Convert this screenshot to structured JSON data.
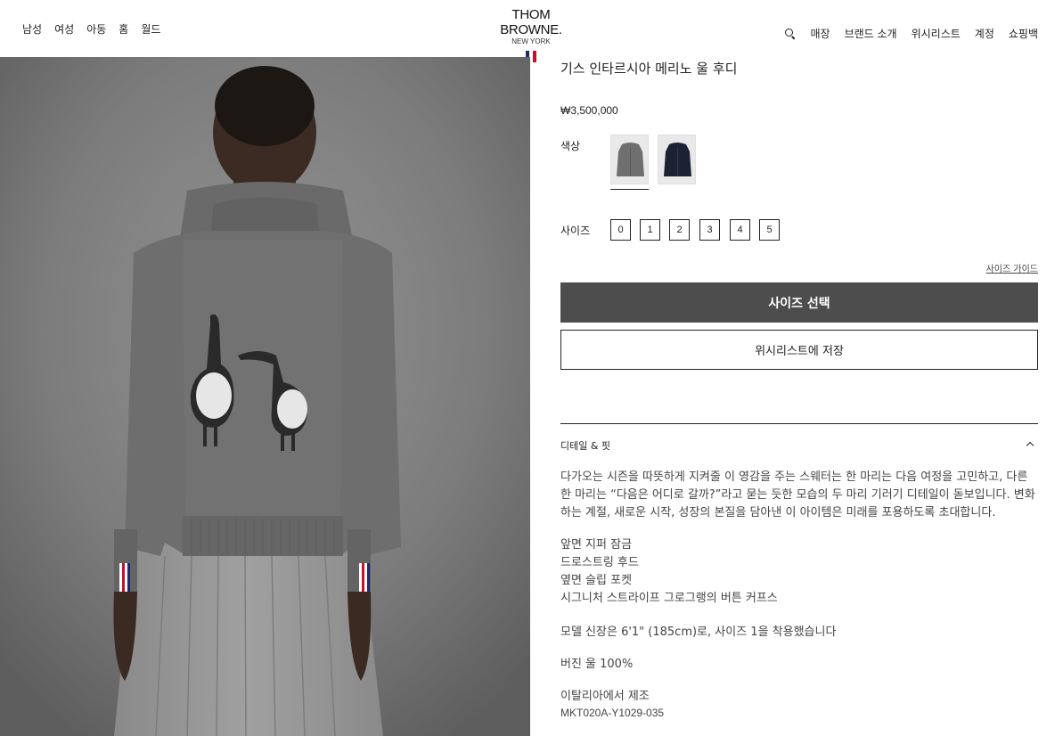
{
  "header": {
    "nav_left": [
      "남성",
      "여성",
      "아동",
      "홈",
      "월드"
    ],
    "logo": {
      "brand": "THOM BROWNE.",
      "city": "NEW YORK"
    },
    "flag_colors": [
      "#1f2a6b",
      "#ffffff",
      "#c8102e"
    ],
    "nav_right": {
      "search_icon": "search-icon",
      "stores": "매장",
      "brand_intro": "브랜드 소개",
      "wishlist": "위시리스트",
      "account": "계정",
      "bag": "쇼핑백"
    }
  },
  "product": {
    "title": "기스 인타르시아 메리노 울 후디",
    "price": "₩3,500,000",
    "color_label": "색상",
    "colors": [
      {
        "name": "grey",
        "hex": "#6f6f6f",
        "selected": true
      },
      {
        "name": "navy",
        "hex": "#1c2233",
        "selected": false
      }
    ],
    "size_label": "사이즈",
    "sizes": [
      "0",
      "1",
      "2",
      "3",
      "4",
      "5"
    ],
    "size_guide": "사이즈 가이드",
    "select_size_button": "사이즈 선택",
    "wishlist_button": "위시리스트에 저장"
  },
  "details": {
    "heading": "디테일 & 핏",
    "expanded": true,
    "description": "다가오는 시즌을 따뜻하게 지켜줄 이 영감을 주는 스웨터는 한 마리는 다음 여정을 고민하고, 다른 한 마리는 “다음은 어디로 갈까?”라고 묻는 듯한 모습의 두 마리 기러기 디테일이 돋보입니다. 변화하는 계절, 새로운 시작, 성장의 본질을 담아낸 이 아이템은 미래를 포용하도록 초대합니다.",
    "features": [
      "앞면 지퍼 잠금",
      "드로스트링 후드",
      "옆면 슬립 포켓",
      "시그니처 스트라이프 그로그랭의 버튼 커프스"
    ],
    "model_info": "모델 신장은 6'1\" (185cm)로, 사이즈 1을 착용했습니다",
    "composition": "버진 울 100%",
    "origin": "이탈리아에서 제조",
    "sku": "MKT020A-Y1029-035"
  }
}
